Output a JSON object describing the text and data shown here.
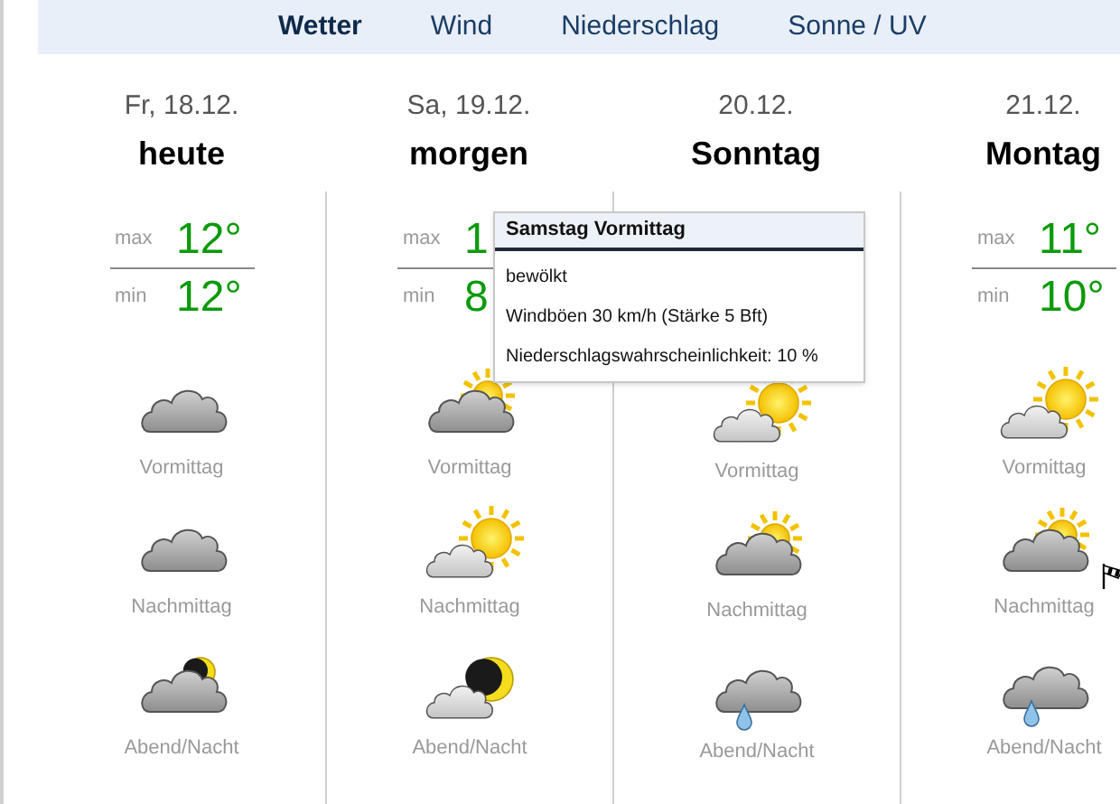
{
  "tabs": [
    {
      "label": "Wetter",
      "selected": true
    },
    {
      "label": "Wind",
      "selected": false
    },
    {
      "label": "Niederschlag",
      "selected": false
    },
    {
      "label": "Sonne / UV",
      "selected": false
    }
  ],
  "days": [
    {
      "date": "Fr, 18.12.",
      "name": "heute",
      "max_label": "max",
      "max_temp": "12°",
      "min_label": "min",
      "min_temp": "12°",
      "periods": [
        {
          "kind": "cloudy",
          "label": "Vormittag"
        },
        {
          "kind": "cloudy",
          "label": "Nachmittag"
        },
        {
          "kind": "cloudy-moon",
          "label": "Abend/Nacht"
        }
      ]
    },
    {
      "date": "Sa, 19.12.",
      "name": "morgen",
      "max_label": "max",
      "max_temp": "1",
      "min_label": "min",
      "min_temp": "8",
      "periods": [
        {
          "kind": "cloudy-sun",
          "label": "Vormittag"
        },
        {
          "kind": "sunny-cloud",
          "label": "Nachmittag"
        },
        {
          "kind": "moon-cloud",
          "label": "Abend/Nacht"
        }
      ]
    },
    {
      "date": "20.12.",
      "name": "Sonntag",
      "periods": [
        {
          "kind": "sunny-cloud",
          "label": "Vormittag"
        },
        {
          "kind": "cloudy-sun",
          "label": "Nachmittag"
        },
        {
          "kind": "rain",
          "label": "Abend/Nacht"
        }
      ]
    },
    {
      "date": "21.12.",
      "name": "Montag",
      "max_label": "max",
      "max_temp": "11°",
      "min_label": "min",
      "min_temp": "10°",
      "periods": [
        {
          "kind": "sunny-cloud",
          "label": "Vormittag"
        },
        {
          "kind": "cloudy-sun",
          "label": "Nachmittag"
        },
        {
          "kind": "rain",
          "label": "Abend/Nacht"
        }
      ]
    }
  ],
  "tooltip": {
    "title": "Samstag Vormittag",
    "lines": [
      "bewölkt",
      "Windböen 30 km/h (Stärke 5 Bft)",
      "Niederschlagswahrscheinlichkeit: 10 %"
    ]
  }
}
